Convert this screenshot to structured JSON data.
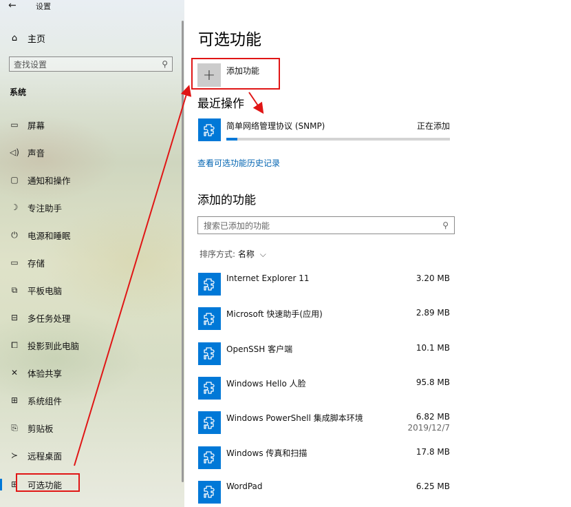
{
  "window": {
    "title": "设置",
    "back_icon": "back-arrow-icon"
  },
  "sidebar": {
    "home_label": "主页",
    "search_placeholder": "查找设置",
    "section_header": "系统",
    "items": [
      {
        "label": "屏幕",
        "icon": "monitor-icon"
      },
      {
        "label": "声音",
        "icon": "speaker-icon"
      },
      {
        "label": "通知和操作",
        "icon": "notification-icon"
      },
      {
        "label": "专注助手",
        "icon": "moon-icon"
      },
      {
        "label": "电源和睡眠",
        "icon": "power-icon"
      },
      {
        "label": "存储",
        "icon": "storage-icon"
      },
      {
        "label": "平板电脑",
        "icon": "tablet-icon"
      },
      {
        "label": "多任务处理",
        "icon": "multitask-icon"
      },
      {
        "label": "投影到此电脑",
        "icon": "project-icon"
      },
      {
        "label": "体验共享",
        "icon": "share-icon"
      },
      {
        "label": "系统组件",
        "icon": "components-icon"
      },
      {
        "label": "剪贴板",
        "icon": "clipboard-icon"
      },
      {
        "label": "远程桌面",
        "icon": "remote-icon"
      },
      {
        "label": "可选功能",
        "icon": "optional-features-icon",
        "active": true
      }
    ]
  },
  "main": {
    "title": "可选功能",
    "add_feature_label": "添加功能",
    "recent_title": "最近操作",
    "recent": {
      "name": "简单网络管理协议 (SNMP)",
      "status": "正在添加",
      "progress": 0.05
    },
    "history_link": "查看可选功能历史记录",
    "added_title": "添加的功能",
    "search_placeholder": "搜索已添加的功能",
    "sort_label": "排序方式: ",
    "sort_value": "名称",
    "features": [
      {
        "name": "Internet Explorer 11",
        "size": "3.20 MB",
        "date": ""
      },
      {
        "name": "Microsoft 快速助手(应用)",
        "size": "2.89 MB",
        "date": ""
      },
      {
        "name": "OpenSSH 客户端",
        "size": "10.1 MB",
        "date": ""
      },
      {
        "name": "Windows Hello 人脸",
        "size": "95.8 MB",
        "date": ""
      },
      {
        "name": "Windows PowerShell 集成脚本环境",
        "size": "6.82 MB",
        "date": "2019/12/7"
      },
      {
        "name": "Windows 传真和扫描",
        "size": "17.8 MB",
        "date": ""
      },
      {
        "name": "WordPad",
        "size": "6.25 MB",
        "date": ""
      }
    ]
  },
  "colors": {
    "accent": "#0078d7",
    "annotation": "#e01515",
    "link": "#0063b1"
  }
}
